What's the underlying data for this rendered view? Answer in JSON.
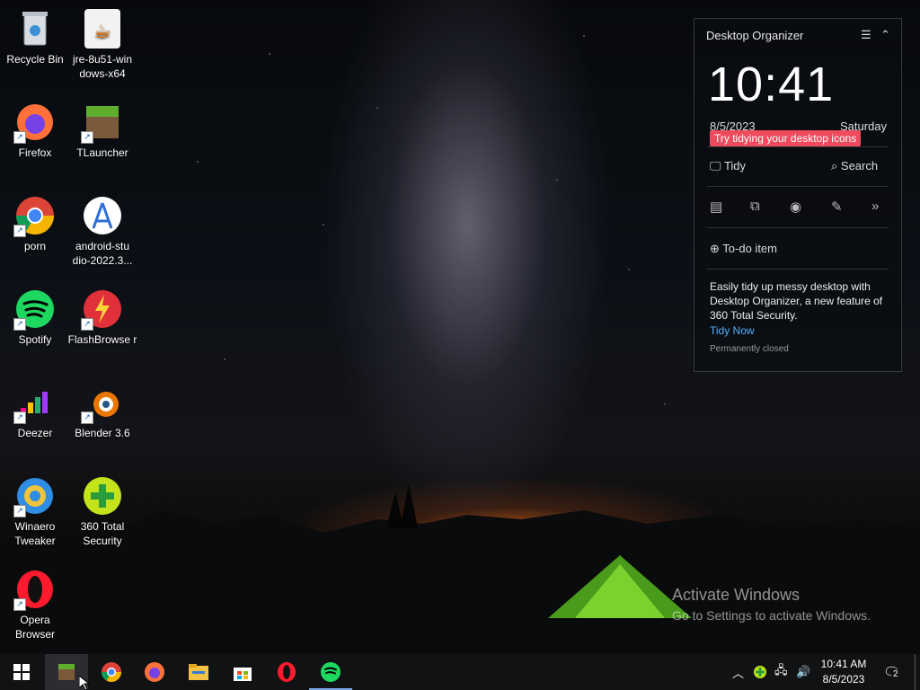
{
  "desktop": {
    "icons": [
      {
        "label": "Recycle Bin",
        "shortcut": false
      },
      {
        "label": "jre-8u51-win dows-x64",
        "shortcut": false
      },
      {
        "label": "Firefox",
        "shortcut": true
      },
      {
        "label": "TLauncher",
        "shortcut": true
      },
      {
        "label": "porn",
        "shortcut": true
      },
      {
        "label": "android-stu dio-2022.3...",
        "shortcut": false
      },
      {
        "label": "Spotify",
        "shortcut": true
      },
      {
        "label": "FlashBrowse r",
        "shortcut": true
      },
      {
        "label": "Deezer",
        "shortcut": true
      },
      {
        "label": "Blender 3.6",
        "shortcut": true
      },
      {
        "label": "Winaero Tweaker",
        "shortcut": true
      },
      {
        "label": "360 Total Security",
        "shortcut": false
      },
      {
        "label": "Opera Browser",
        "shortcut": true
      }
    ]
  },
  "organizer": {
    "title": "Desktop Organizer",
    "menu_icon": "menu-icon",
    "collapse_icon": "chevron-up-icon",
    "clock": "10:41",
    "date": "8/5/2023",
    "day": "Saturday",
    "tip": "Try tidying your desktop icons",
    "tidy_label": "Tidy",
    "search_label": "Search",
    "tools": [
      "copy-icon",
      "crop-icon",
      "eye-icon",
      "note-icon",
      "double-chevron-right-icon"
    ],
    "todo_label": "To-do item",
    "promo_text": "Easily tidy up messy desktop with Desktop Organizer, a new feature of 360 Total Security.",
    "promo_link": "Tidy Now",
    "closed_text": "Permanently closed"
  },
  "watermark": {
    "line1": "Activate Windows",
    "line2": "Go to Settings to activate Windows."
  },
  "taskbar": {
    "apps": [
      "windows-start-icon",
      "tlauncher-icon",
      "chrome-icon",
      "firefox-icon",
      "file-explorer-icon",
      "microsoft-store-icon",
      "opera-icon",
      "spotify-icon"
    ],
    "time": "10:41 AM",
    "date": "8/5/2023",
    "notifications": "2"
  },
  "colors": {
    "tip_bg": "#ee4b5e",
    "link": "#4fb3ff",
    "taskbar": "#111214"
  }
}
